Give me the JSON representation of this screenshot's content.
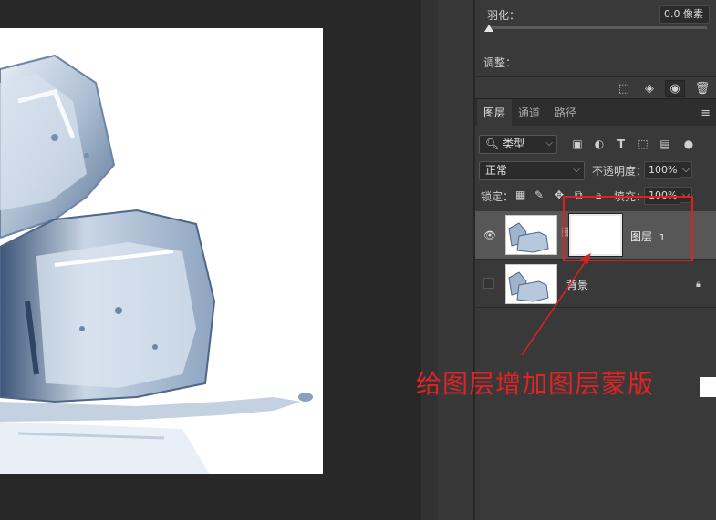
{
  "properties": {
    "feather_label": "羽化：",
    "feather_value": "0.0 像素",
    "adjust_label": "调整："
  },
  "icon_bar": {
    "icons": [
      "selection-icon",
      "mask-apply-icon",
      "visibility-icon",
      "trash-icon"
    ]
  },
  "layers_panel": {
    "tabs": [
      {
        "label": "图层",
        "active": true
      },
      {
        "label": "通道",
        "active": false
      },
      {
        "label": "路径",
        "active": false
      }
    ],
    "menu_icon": "≡",
    "filter_kind": "类型",
    "blend_mode": "正常",
    "opacity_label": "不透明度：",
    "opacity_value": "100%",
    "lock_label": "锁定：",
    "fill_label": "填充：",
    "fill_value": "100%",
    "layers": [
      {
        "name": "图层",
        "number": "1",
        "visible": true,
        "selected": true,
        "has_mask": true
      },
      {
        "name": "背景",
        "number": "",
        "visible": false,
        "selected": false,
        "locked": true
      }
    ]
  },
  "annotation": {
    "text": "给图层增加图层蒙版",
    "color": "#e02424"
  }
}
